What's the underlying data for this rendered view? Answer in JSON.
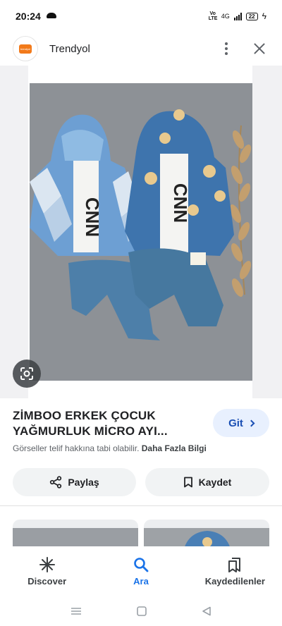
{
  "status_bar": {
    "time": "20:24",
    "volte": "Vo LTE",
    "network": "4G",
    "battery": "22"
  },
  "header": {
    "site_name": "Trendyol",
    "logo_text": "trendyol"
  },
  "product": {
    "title": "ZİMBOO ERKEK ÇOCUK YAĞMURLUK MİCRO AYI...",
    "visit_label": "Git",
    "copyright_text": "Görseller telif hakkına tabi olabilir.",
    "more_info_label": "Daha Fazla Bilgi"
  },
  "actions": {
    "share_label": "Paylaş",
    "save_label": "Kaydet"
  },
  "photo": {
    "shirt_print": "CNN"
  },
  "bottom_nav": [
    {
      "label": "Discover",
      "icon": "asterisk-icon",
      "active": false
    },
    {
      "label": "Ara",
      "icon": "search-icon",
      "active": true
    },
    {
      "label": "Kaydedilenler",
      "icon": "bookmarks-icon",
      "active": false
    }
  ],
  "colors": {
    "accent": "#1a73e8",
    "brand": "#f27a1a",
    "visit_bg": "#e8f0fe"
  }
}
